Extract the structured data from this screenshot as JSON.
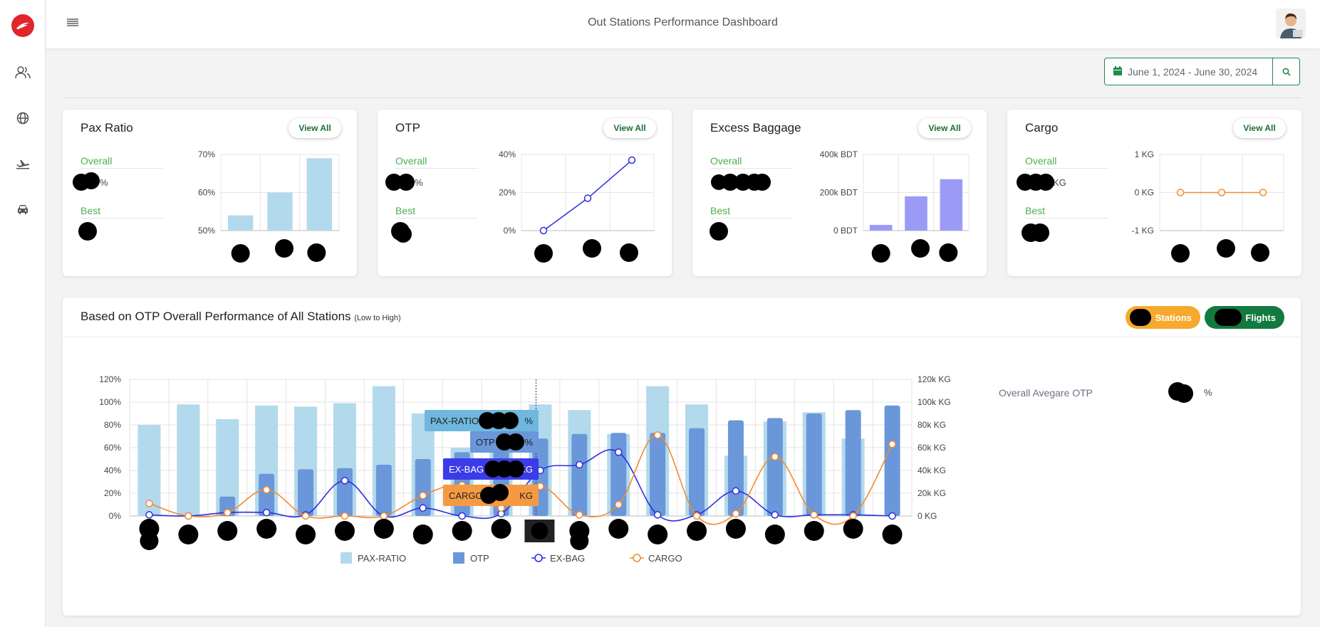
{
  "header": {
    "title": "Out Stations Performance Dashboard"
  },
  "sidebar": {
    "icons": [
      "logo-icon",
      "users-icon",
      "globe-icon",
      "plane-icon",
      "car-icon"
    ]
  },
  "date_range": {
    "value": "June 1, 2024 - June 30, 2024"
  },
  "cards": [
    {
      "title": "Pax Ratio",
      "view_all": "View All",
      "overall_label": "Overall",
      "overall_value": "%",
      "best_label": "Best",
      "best_value": ""
    },
    {
      "title": "OTP",
      "view_all": "View All",
      "overall_label": "Overall",
      "overall_value": "%",
      "best_label": "Best",
      "best_value": ""
    },
    {
      "title": "Excess Baggage",
      "view_all": "View All",
      "overall_label": "Overall",
      "overall_value": "",
      "best_label": "Best",
      "best_value": ""
    },
    {
      "title": "Cargo",
      "view_all": "View All",
      "overall_label": "Overall",
      "overall_value": "KG",
      "best_label": "Best",
      "best_value": ""
    }
  ],
  "main": {
    "title": "Based on OTP Overall Performance of All Stations",
    "subtitle": "(Low to High)",
    "toggle_stations": "Stations",
    "toggle_flights": "Flights",
    "avg_label": "Overall Avegare OTP",
    "avg_value": "%"
  },
  "colors": {
    "green": "#1f8a4c",
    "pax_bar": "#b3d9ec",
    "otp_bar": "#6a97d9",
    "exbag_line": "#2d2ee0",
    "cargo_line": "#f28b30",
    "mini_bar_pax": "#b3d9ec",
    "mini_bar_exbag": "#9b9bf6"
  },
  "chart_data": [
    {
      "type": "bar",
      "title": "Pax Ratio",
      "ylim": [
        50,
        70
      ],
      "yticks": [
        "70%",
        "60%",
        "50%"
      ],
      "values": [
        54,
        60,
        69
      ]
    },
    {
      "type": "line",
      "title": "OTP",
      "ylim": [
        0,
        40
      ],
      "yticks": [
        "40%",
        "20%",
        "0%"
      ],
      "values": [
        0,
        17,
        37
      ]
    },
    {
      "type": "bar",
      "title": "Excess Baggage",
      "ylim": [
        0,
        400000
      ],
      "yticks": [
        "400k BDT",
        "200k BDT",
        "0 BDT"
      ],
      "values": [
        30000,
        180000,
        270000
      ]
    },
    {
      "type": "line",
      "title": "Cargo",
      "ylim": [
        -1,
        1
      ],
      "yticks": [
        "1 KG",
        "0 KG",
        "-1 KG"
      ],
      "values": [
        0,
        0,
        0
      ]
    },
    {
      "type": "bar",
      "title": "Based on OTP Overall Performance of All Stations",
      "y_left_ticks": [
        "120%",
        "100%",
        "80%",
        "60%",
        "40%",
        "20%",
        "0%"
      ],
      "y_right_ticks": [
        "120k KG",
        "100k KG",
        "80k KG",
        "60k KG",
        "40k KG",
        "20k KG",
        "0 KG"
      ],
      "ylim_left": [
        0,
        120
      ],
      "ylim_right": [
        0,
        120000
      ],
      "legend": [
        "PAX-RATIO",
        "OTP",
        "EX-BAG",
        "CARGO"
      ],
      "series": [
        {
          "name": "PAX-RATIO",
          "values": [
            80,
            98,
            85,
            97,
            96,
            99,
            114,
            90,
            60,
            76,
            98,
            93,
            72,
            114,
            98,
            53,
            83,
            91,
            68
          ]
        },
        {
          "name": "OTP",
          "values": [
            0,
            17,
            37,
            41,
            42,
            45,
            50,
            56,
            62,
            68,
            72,
            73,
            73,
            77,
            84,
            86,
            90,
            93,
            97
          ]
        },
        {
          "name": "EX-BAG",
          "values": [
            1000,
            0,
            3000,
            3000,
            1000,
            31000,
            0,
            7000,
            0,
            2000,
            40000,
            45000,
            56000,
            1000,
            1000,
            22000,
            1000,
            1000,
            1000,
            0
          ]
        },
        {
          "name": "CARGO",
          "values": [
            11000,
            0,
            3000,
            23000,
            0,
            0,
            0,
            18000,
            27000,
            7000,
            26000,
            1000,
            10000,
            71000,
            0,
            2000,
            52000,
            1000,
            0,
            63000
          ]
        }
      ],
      "tooltip": {
        "pax_label": "PAX-RATIO",
        "pax_suffix": "%",
        "otp_label": "OTP",
        "otp_suffix": "%",
        "exbag_label": "EX-BAG",
        "exbag_suffix": "KG",
        "cargo_label": "CARGO",
        "cargo_suffix": "KG"
      }
    }
  ]
}
